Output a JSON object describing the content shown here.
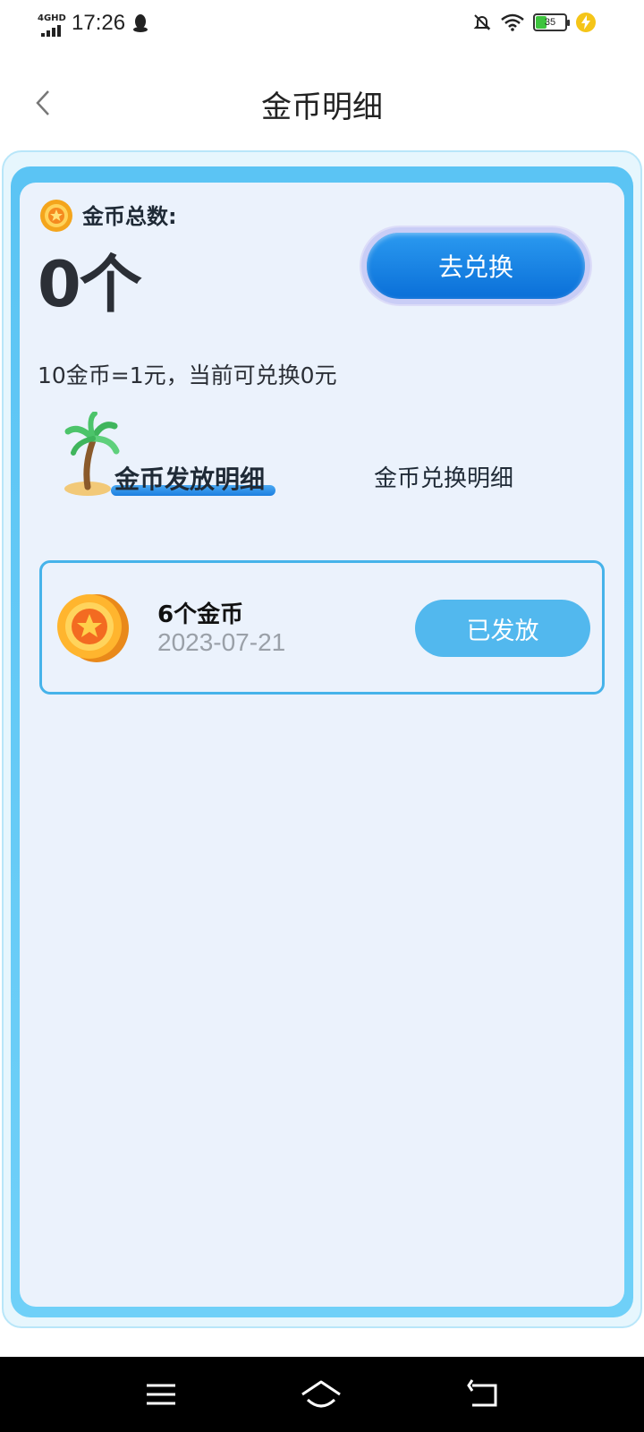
{
  "status_bar": {
    "network": "4GHD",
    "time": "17:26",
    "battery": "35",
    "icons": [
      "signal-icon",
      "qq-icon",
      "mute-icon",
      "wifi-icon",
      "battery-icon",
      "charging-icon"
    ]
  },
  "header": {
    "title": "金币明细",
    "back_icon": "chevron-left-icon"
  },
  "summary": {
    "total_label": "金币总数:",
    "total_value": "0个",
    "exchange_button": "去兑换",
    "rate_text": "10金币=1元，当前可兑换0元"
  },
  "tabs": {
    "issue": "金币发放明细",
    "exchange": "金币兑换明细",
    "active": "issue"
  },
  "records": [
    {
      "title": "6个金币",
      "date": "2023-07-21",
      "status": "已发放"
    }
  ],
  "colors": {
    "accent": "#0a6fd8",
    "status_button": "#52b8ee",
    "card_border": "#46b3ea",
    "frame": "#5bc4f4",
    "background": "#ebf2fc"
  },
  "nav_bar": {
    "icons": [
      "menu-icon",
      "home-icon",
      "back-icon"
    ]
  }
}
